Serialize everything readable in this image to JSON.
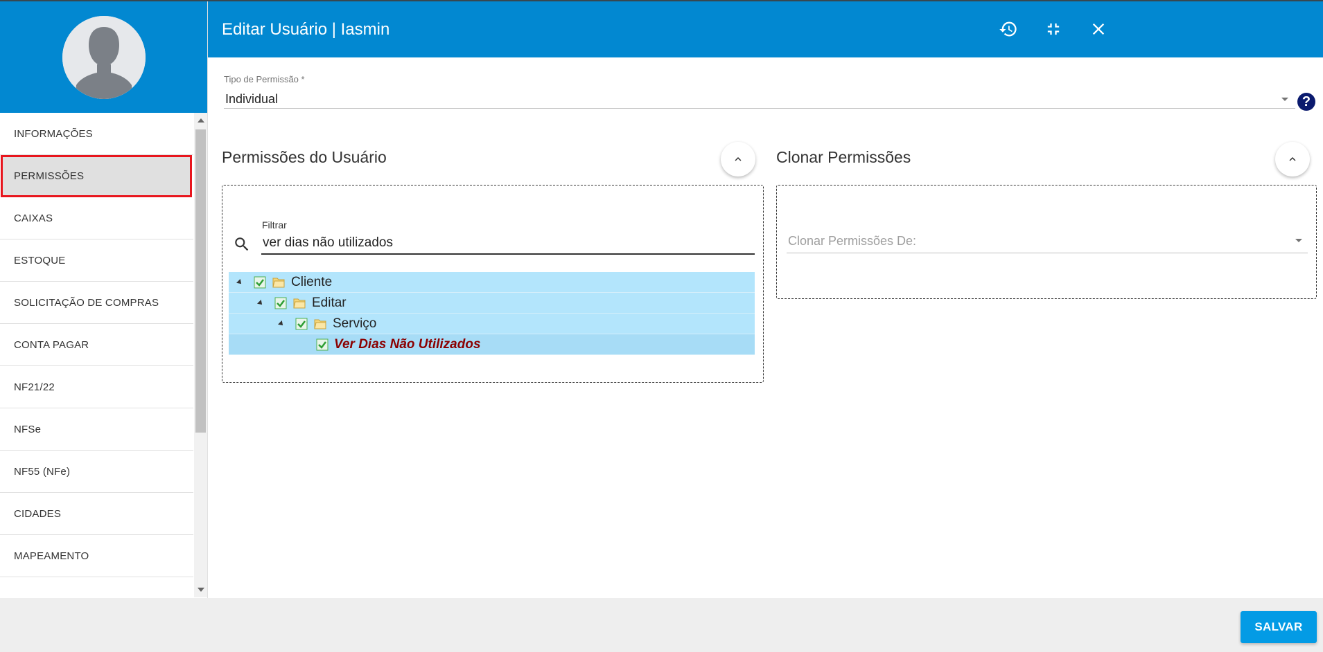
{
  "header": {
    "title": "Editar Usuário | Iasmin",
    "icons": [
      "history-icon",
      "fullscreen-exit-icon",
      "close-icon"
    ]
  },
  "sidebar": {
    "items": [
      {
        "label": "INFORMAÇÕES"
      },
      {
        "label": "PERMISSÕES",
        "active": true
      },
      {
        "label": "CAIXAS"
      },
      {
        "label": "ESTOQUE"
      },
      {
        "label": "SOLICITAÇÃO DE COMPRAS"
      },
      {
        "label": "CONTA PAGAR"
      },
      {
        "label": "NF21/22"
      },
      {
        "label": "NFSe"
      },
      {
        "label": "NF55 (NFe)"
      },
      {
        "label": "CIDADES"
      },
      {
        "label": "MAPEAMENTO"
      }
    ]
  },
  "permission_type": {
    "label": "Tipo de Permissão",
    "required_mark": "*",
    "value": "Individual"
  },
  "user_permissions": {
    "title": "Permissões do Usuário",
    "filter_label": "Filtrar",
    "filter_value": "ver dias não utilizados",
    "tree": [
      {
        "label": "Cliente",
        "level": 0,
        "expanded": true,
        "checked": true
      },
      {
        "label": "Editar",
        "level": 1,
        "expanded": true,
        "checked": true
      },
      {
        "label": "Serviço",
        "level": 2,
        "expanded": true,
        "checked": true
      },
      {
        "label": "Ver Dias Não Utilizados",
        "level": 3,
        "checked": true,
        "match": true
      }
    ]
  },
  "clone_permissions": {
    "title": "Clonar Permissões",
    "placeholder": "Clonar Permissões De:"
  },
  "footer": {
    "save_label": "SALVAR"
  },
  "colors": {
    "primary": "#0288d1",
    "save_button": "#039be5",
    "tree_highlight": "#b3e5fc",
    "active_border": "#e8151d",
    "match_text": "#8b0000"
  }
}
